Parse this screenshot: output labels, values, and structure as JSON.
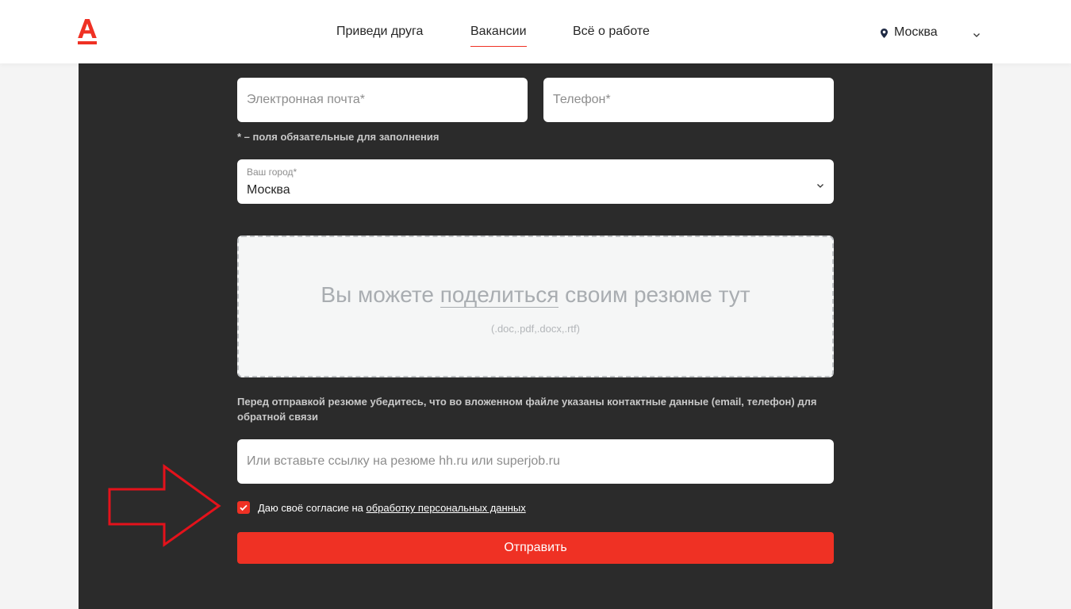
{
  "header": {
    "nav": [
      {
        "label": "Приведи друга",
        "active": false
      },
      {
        "label": "Вакансии",
        "active": true
      },
      {
        "label": "Всё о работе",
        "active": false
      }
    ],
    "city": "Москва",
    "icons": {
      "logo": "alfa-logo",
      "location": "location-pin-icon",
      "dropdown": "chevron-down-icon"
    }
  },
  "form": {
    "email_placeholder": "Электронная почта*",
    "phone_placeholder": "Телефон*",
    "required_note": "* – поля обязательные для заполнения",
    "city_field": {
      "label": "Ваш город*",
      "value": "Москва"
    },
    "dropzone": {
      "prefix": "Вы можете ",
      "link": "поделиться",
      "suffix": " своим резюме тут",
      "formats": "(.doc,.pdf,.docx,.rtf)"
    },
    "resume_note": "Перед отправкой резюме убедитесь, что во вложенном файле указаны контактные данные (email, телефон) для обратной связи",
    "link_placeholder": "Или вставьте ссылку на резюме hh.ru или superjob.ru",
    "consent": {
      "checked": true,
      "prefix": "Даю своё согласие на ",
      "link": "обработку персональных данных"
    },
    "submit_label": "Отправить"
  },
  "colors": {
    "accent": "#ef3124",
    "panel": "#2b2b2b",
    "header": "#ffffff"
  }
}
